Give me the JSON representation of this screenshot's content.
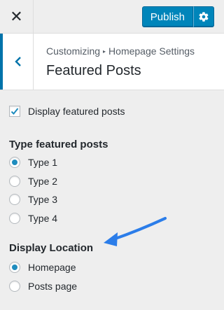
{
  "topbar": {
    "close_icon": "✕",
    "publish_label": "Publish",
    "settings_icon": "gear-icon"
  },
  "section": {
    "breadcrumb_parent": "Customizing",
    "breadcrumb_separator": "▸",
    "breadcrumb_current": "Homepage Settings",
    "title": "Featured Posts",
    "back_icon": "chevron-left-icon"
  },
  "display_featured": {
    "label": "Display featured posts",
    "checked": true
  },
  "type_featured": {
    "title": "Type featured posts",
    "options": [
      {
        "label": "Type 1",
        "selected": true
      },
      {
        "label": "Type 2",
        "selected": false
      },
      {
        "label": "Type 3",
        "selected": false
      },
      {
        "label": "Type 4",
        "selected": false
      }
    ]
  },
  "display_location": {
    "title": "Display Location",
    "options": [
      {
        "label": "Homepage",
        "selected": true
      },
      {
        "label": "Posts page",
        "selected": false
      }
    ]
  },
  "annotation": {
    "icon": "arrow-pointer-icon"
  },
  "colors": {
    "accent": "#0085ba",
    "radio_checked": "#1e8cbe",
    "annotation_arrow": "#2b7de9",
    "background": "#eeeeee"
  }
}
